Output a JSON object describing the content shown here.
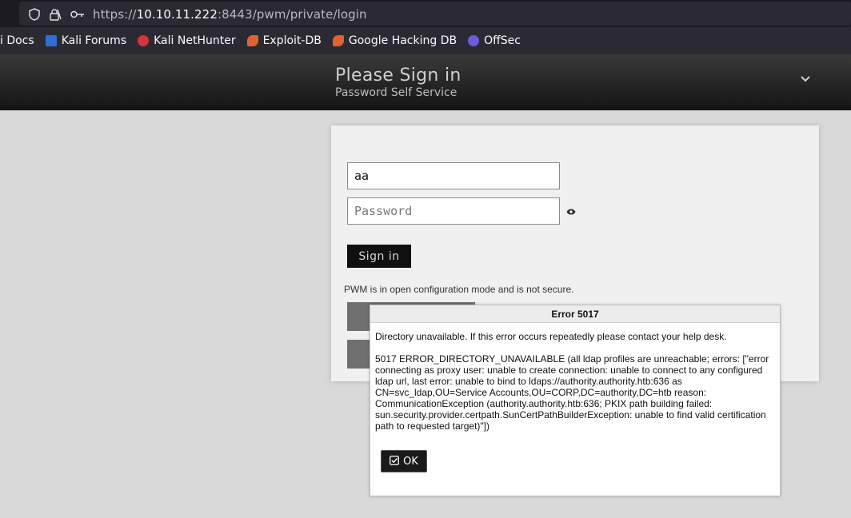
{
  "browser": {
    "url_scheme": "https://",
    "url_host": "10.10.11.222",
    "url_rest": ":8443/pwm/private/login",
    "icons": [
      "shield-icon",
      "lock-icon",
      "key-icon"
    ]
  },
  "bookmarks": [
    {
      "label": "i Docs",
      "icon": "",
      "color": ""
    },
    {
      "label": "Kali Forums",
      "icon": "kali-forums-icon",
      "color": "#2f6fd6"
    },
    {
      "label": "Kali NetHunter",
      "icon": "kali-nethunter-icon",
      "color": "#d8323c"
    },
    {
      "label": "Exploit-DB",
      "icon": "exploit-db-icon",
      "color": "#e0642a"
    },
    {
      "label": "Google Hacking DB",
      "icon": "ghdb-icon",
      "color": "#e0642a"
    },
    {
      "label": "OffSec",
      "icon": "offsec-icon",
      "color": "#6a5ae0"
    }
  ],
  "header": {
    "title": "Please Sign in",
    "subtitle": "Password Self Service"
  },
  "login": {
    "username_value": "aa",
    "password_placeholder": "Password",
    "signin_label": "Sign in",
    "warning": "PWM is in open configuration mode and is not secure."
  },
  "error_dialog": {
    "title": "Error 5017",
    "message": "Directory unavailable. If this error occurs repeatedly please contact your help desk.",
    "detail": "5017 ERROR_DIRECTORY_UNAVAILABLE (all ldap profiles are unreachable; errors: [\"error connecting as proxy user: unable to create connection: unable to connect to any configured ldap url, last error: unable to bind to ldaps://authority.authority.htb:636 as CN=svc_ldap,OU=Service Accounts,OU=CORP,DC=authority,DC=htb reason: CommunicationException (authority.authority.htb:636; PKIX path building failed: sun.security.provider.certpath.SunCertPathBuilderException: unable to find valid certification path to requested target)\"])",
    "ok_label": "OK"
  }
}
